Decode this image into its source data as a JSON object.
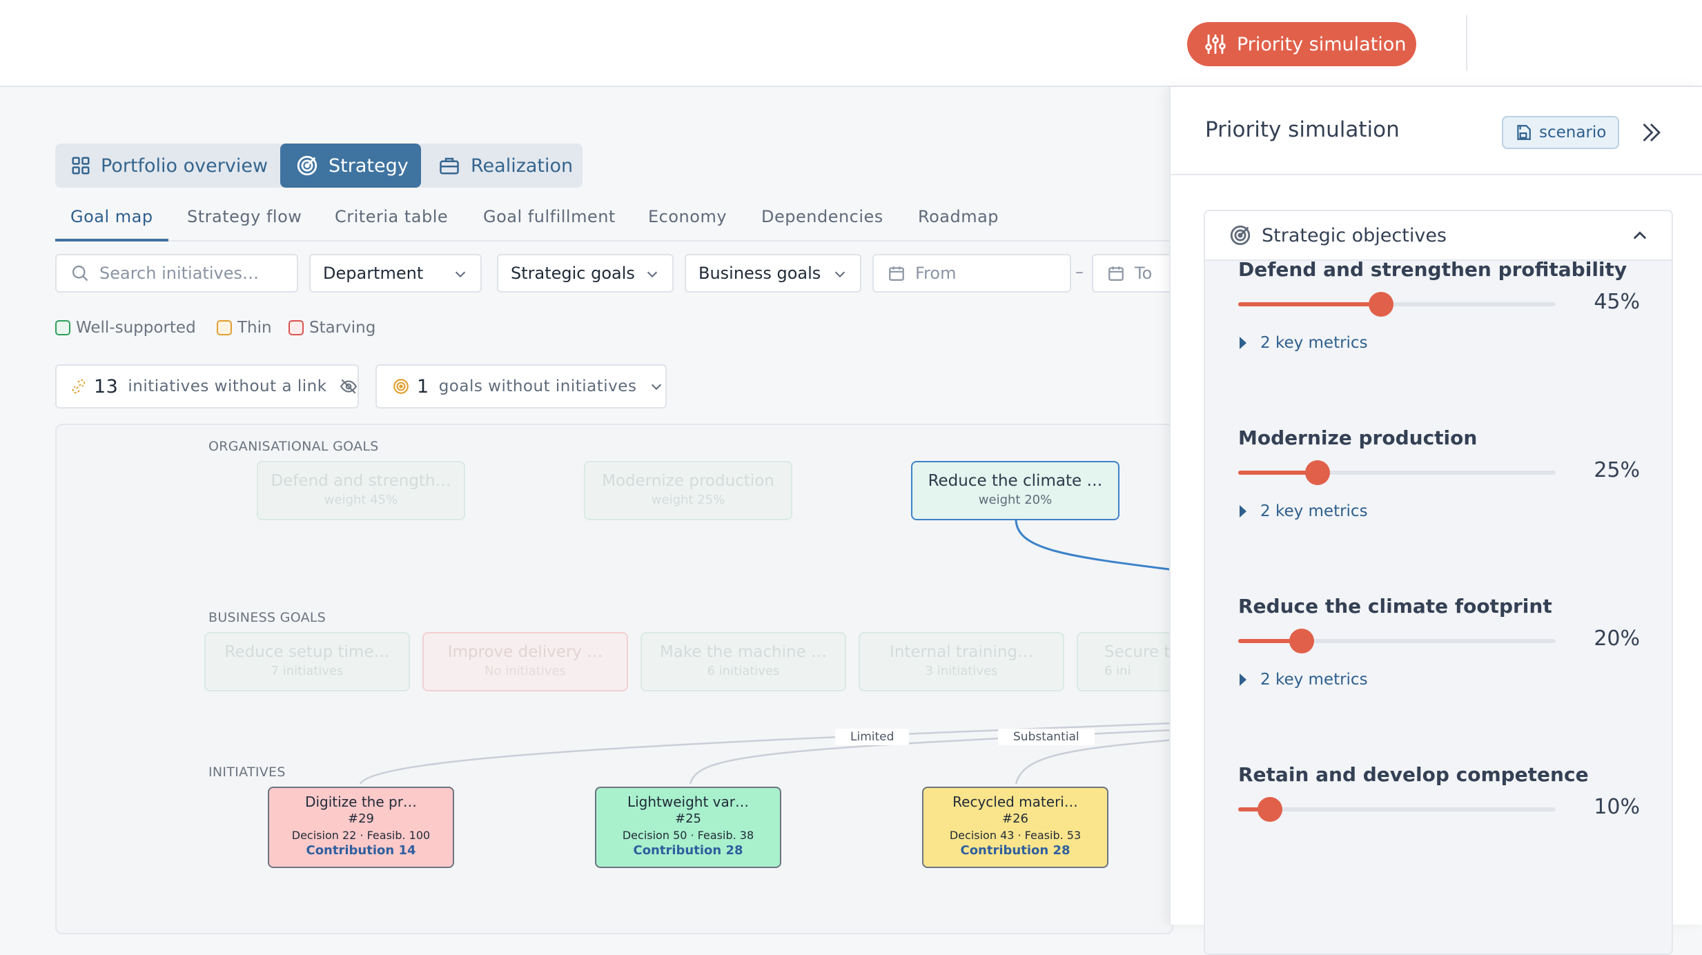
{
  "topbar": {
    "priority_button": "Priority simulation"
  },
  "views": [
    {
      "label": "Portfolio overview",
      "active": false
    },
    {
      "label": "Strategy",
      "active": true
    },
    {
      "label": "Realization",
      "active": false
    }
  ],
  "subtabs": [
    "Goal map",
    "Strategy flow",
    "Criteria table",
    "Goal fulfillment",
    "Economy",
    "Dependencies",
    "Roadmap"
  ],
  "filters": {
    "search_placeholder": "Search initiatives…",
    "department": "Department",
    "strategic_goals": "Strategic goals",
    "business_goals": "Business goals",
    "from": "From",
    "dash": "–",
    "to": "To"
  },
  "legend": [
    {
      "label": "Well-supported",
      "color": "#2f9e5b"
    },
    {
      "label": "Thin",
      "color": "#e0a030"
    },
    {
      "label": "Starving",
      "color": "#d9534f"
    }
  ],
  "alerts": {
    "unlinked_count": "13",
    "unlinked_label": "initiatives without a link",
    "goals_count": "1",
    "goals_label": "goals without initiatives"
  },
  "map": {
    "org_label": "ORGANISATIONAL GOALS",
    "biz_label": "BUSINESS GOALS",
    "init_label": "INITIATIVES",
    "org_goals": [
      {
        "title": "Defend and strength…",
        "sub": "weight 45%"
      },
      {
        "title": "Modernize production",
        "sub": "weight 25%"
      },
      {
        "title": "Reduce the climate …",
        "sub": "weight 20%"
      }
    ],
    "biz_goals": [
      {
        "title": "Reduce setup time…",
        "sub": "7 initiatives"
      },
      {
        "title": "Improve delivery …",
        "sub": "No initiatives"
      },
      {
        "title": "Make the machine …",
        "sub": "6 initiatives"
      },
      {
        "title": "Internal training…",
        "sub": "3 initiatives"
      },
      {
        "title": "Secure t",
        "sub": "6 ini"
      }
    ],
    "initiatives": [
      {
        "title": "Digitize the pr…",
        "num": "#29",
        "detail": "Decision 22 · Feasib. 100",
        "contribution": "Contribution 14",
        "color": "#fdcaca"
      },
      {
        "title": "Lightweight var…",
        "num": "#25",
        "detail": "Decision 50 · Feasib. 38",
        "contribution": "Contribution 28",
        "color": "#a9f0cd"
      },
      {
        "title": "Recycled materi…",
        "num": "#26",
        "detail": "Decision 43 · Feasib. 53",
        "contribution": "Contribution 28",
        "color": "#fbe58c"
      }
    ],
    "edge_labels": [
      "Limited",
      "Substantial"
    ]
  },
  "panel": {
    "title": "Priority simulation",
    "scenario": "scenario",
    "section_title": "Strategic objectives",
    "objectives": [
      {
        "name": "Defend and strengthen profitability",
        "value": 45,
        "pct": "45%",
        "metrics": "2 key metrics"
      },
      {
        "name": "Modernize production",
        "value": 25,
        "pct": "25%",
        "metrics": "2 key metrics"
      },
      {
        "name": "Reduce the climate footprint",
        "value": 20,
        "pct": "20%",
        "metrics": "2 key metrics"
      },
      {
        "name": "Retain and develop competence",
        "value": 10,
        "pct": "10%",
        "metrics": "2 key metrics"
      }
    ]
  },
  "colors": {
    "accent": "#e1604a",
    "primary": "#3f73a0"
  }
}
